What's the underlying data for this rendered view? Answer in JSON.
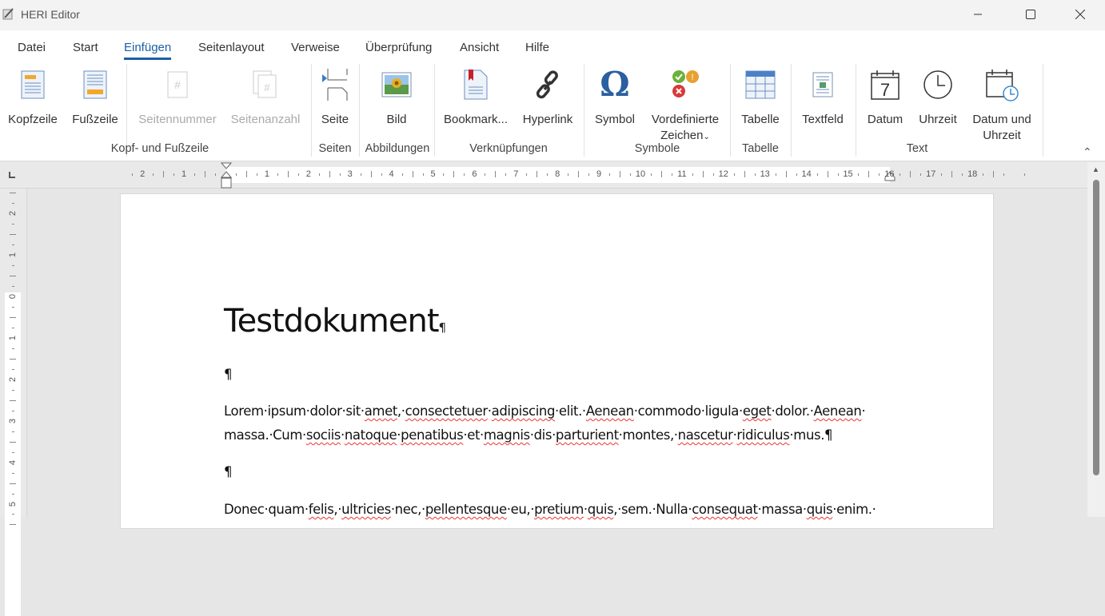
{
  "window": {
    "title": "HERI Editor"
  },
  "menu": [
    "Datei",
    "Start",
    "Einfügen",
    "Seitenlayout",
    "Verweise",
    "Überprüfung",
    "Ansicht",
    "Hilfe"
  ],
  "ribbon": {
    "buttons": {
      "kopfzeile": "Kopfzeile",
      "fusszeile": "Fußzeile",
      "seitennummer": "Seitennummer",
      "seitenanzahl": "Seitenanzahl",
      "seite": "Seite",
      "bild": "Bild",
      "bookmark": "Bookmark...",
      "hyperlink": "Hyperlink",
      "symbol": "Symbol",
      "vordefinierte1": "Vordefinierte",
      "vordefinierte2": "Zeichen",
      "tabelle": "Tabelle",
      "textfeld": "Textfeld",
      "datum": "Datum",
      "uhrzeit": "Uhrzeit",
      "datumuhrzeit1": "Datum und",
      "datumuhrzeit2": "Uhrzeit",
      "datum_icon_day": "7"
    },
    "groups": {
      "kopf": "Kopf- und Fußzeile",
      "seiten": "Seiten",
      "abbildungen": "Abbildungen",
      "verknuepfungen": "Verknüpfungen",
      "symbole": "Symbole",
      "tabelle": "Tabelle",
      "text": "Text"
    }
  },
  "ruler": {
    "labels": [
      "2",
      "1",
      "1",
      "2",
      "3",
      "4",
      "5",
      "6",
      "7",
      "8",
      "9",
      "10",
      "11",
      "12",
      "13",
      "14",
      "15",
      "16",
      "17",
      "18"
    ],
    "vlabels": [
      "2",
      "1",
      "0",
      "1",
      "2",
      "3",
      "4",
      "5"
    ]
  },
  "document": {
    "title": "Testdokument",
    "pilcrow": "¶",
    "p1": "Lorem·ipsum·dolor·sit·amet,·consectetuer·adipiscing·elit.·Aenean·commodo·ligula·eget·dolor.·Aenean·",
    "p1b": "massa.·Cum·sociis·natoque·penatibus·et·magnis·dis·parturient·montes,·nascetur·ridiculus·mus.",
    "p2": "Donec·quam·felis,·ultricies·nec,·pellentesque·eu,·pretium·quis,·sem.·Nulla·consequat·massa·quis·enim.·"
  }
}
